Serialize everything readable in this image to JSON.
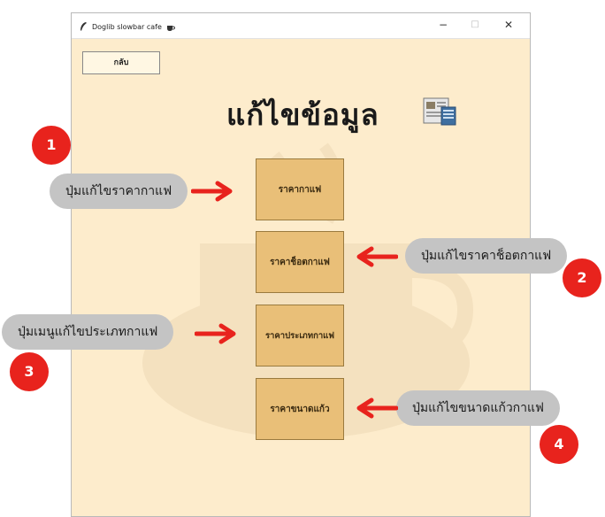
{
  "window": {
    "title": "Doglib slowbar cafe",
    "controls": {
      "minimize": "−",
      "maximize": "□",
      "close": "✕"
    }
  },
  "back_button": "กลับ",
  "heading": "แก้ไขข้อมูล",
  "menu_buttons": [
    {
      "label": "ราคากาแฟ"
    },
    {
      "label": "ราคาช็อตกาแฟ"
    },
    {
      "label": "ราคาประเภทกาแฟ"
    },
    {
      "label": "ราคาขนาดแก้ว"
    }
  ],
  "annotations": [
    {
      "number": "1",
      "text": "ปุ่มแก้ไขราคากาแฟ"
    },
    {
      "number": "2",
      "text": "ปุ่มแก้ไขราคาช็อตกาแฟ"
    },
    {
      "number": "3",
      "text": "ปุ่มเมนูแก้ไขประเภทกาแฟ"
    },
    {
      "number": "4",
      "text": "ปุ่มแก้ไขขนาดแก้วกาแฟ"
    }
  ],
  "colors": {
    "window_bg": "#fdeccc",
    "button_bg": "#e9bf78",
    "badge": "#e8231d",
    "callout": "#c4c4c4",
    "arrow": "#e8231d"
  },
  "icons": {
    "app": "feather-icon",
    "title_cup": "coffee-cup-icon",
    "heading": "newspaper-icon"
  }
}
